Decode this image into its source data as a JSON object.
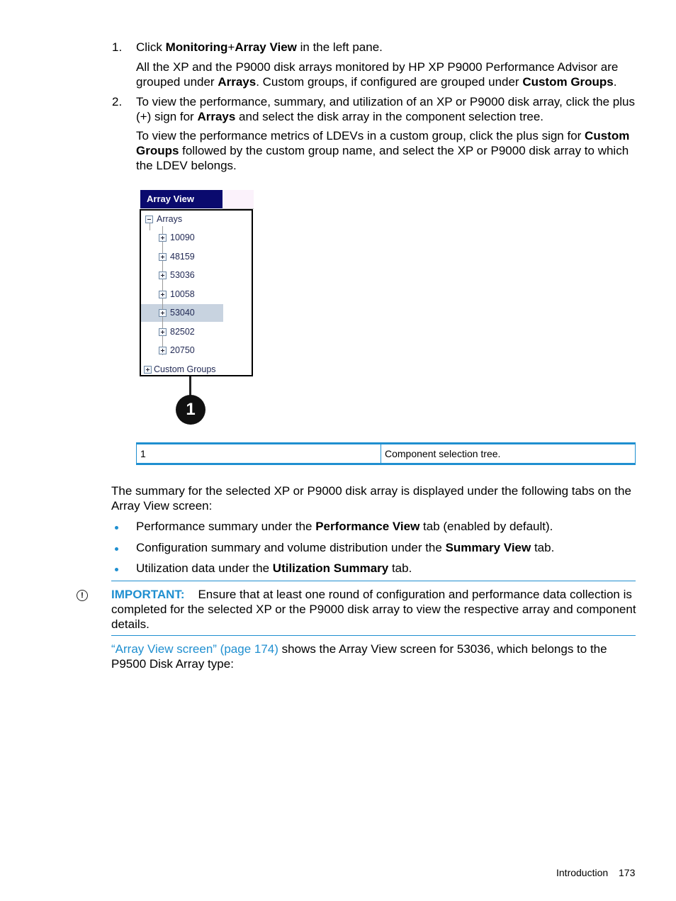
{
  "steps": [
    {
      "number": "1.",
      "text_parts": [
        "Click ",
        "Monitoring",
        "+",
        "Array View",
        " in the left pane."
      ],
      "detail_parts": [
        "All the XP and the P9000 disk arrays monitored by HP XP P9000 Performance Advisor are grouped under ",
        "Arrays",
        ". Custom groups, if configured are grouped under ",
        "Custom Groups",
        "."
      ]
    },
    {
      "number": "2.",
      "text_parts": [
        "To view the performance, summary, and utilization of an XP or P9000 disk array, click the plus (+) sign for ",
        "Arrays",
        " and select the disk array in the component selection tree."
      ],
      "detail_parts": [
        "To view the performance metrics of LDEVs in a custom group, click the plus sign for ",
        "Custom Groups",
        " followed by the custom group name, and select the XP or P9000 disk array to which the LDEV belongs."
      ]
    }
  ],
  "figure": {
    "header": "Array View",
    "root": "Arrays",
    "arrays": [
      "10090",
      "48159",
      "53036",
      "10058",
      "53040",
      "82502",
      "20750"
    ],
    "selected": "53040",
    "custom_groups": "Custom Groups",
    "callout": "1"
  },
  "legend": [
    {
      "number": "1",
      "description": "Component selection tree."
    }
  ],
  "summary": {
    "intro": "The summary for the selected XP or P9000 disk array is displayed under the following tabs on the Array View screen:",
    "bullets": [
      {
        "pre": "Performance summary under the ",
        "bold": "Performance View",
        "post": " tab (enabled by default)."
      },
      {
        "pre": "Configuration summary and volume distribution under the ",
        "bold": "Summary View",
        "post": " tab."
      },
      {
        "pre": "Utilization data under the ",
        "bold": "Utilization Summary",
        "post": " tab."
      }
    ]
  },
  "important": {
    "label": "IMPORTANT:",
    "text": "Ensure that at least one round of configuration and performance data collection is completed for the selected XP or the P9000 disk array to view the respective array and component details."
  },
  "reference": {
    "link": "“Array View screen” (page 174)",
    "text": " shows the Array View screen for 53036, which belongs to the P9500 Disk Array type:"
  },
  "footer": {
    "section": "Introduction",
    "page": "173"
  },
  "colors": {
    "accent": "#1f8fd0",
    "header_bg": "#0a0a6e",
    "selection": "#c8d3e0"
  }
}
